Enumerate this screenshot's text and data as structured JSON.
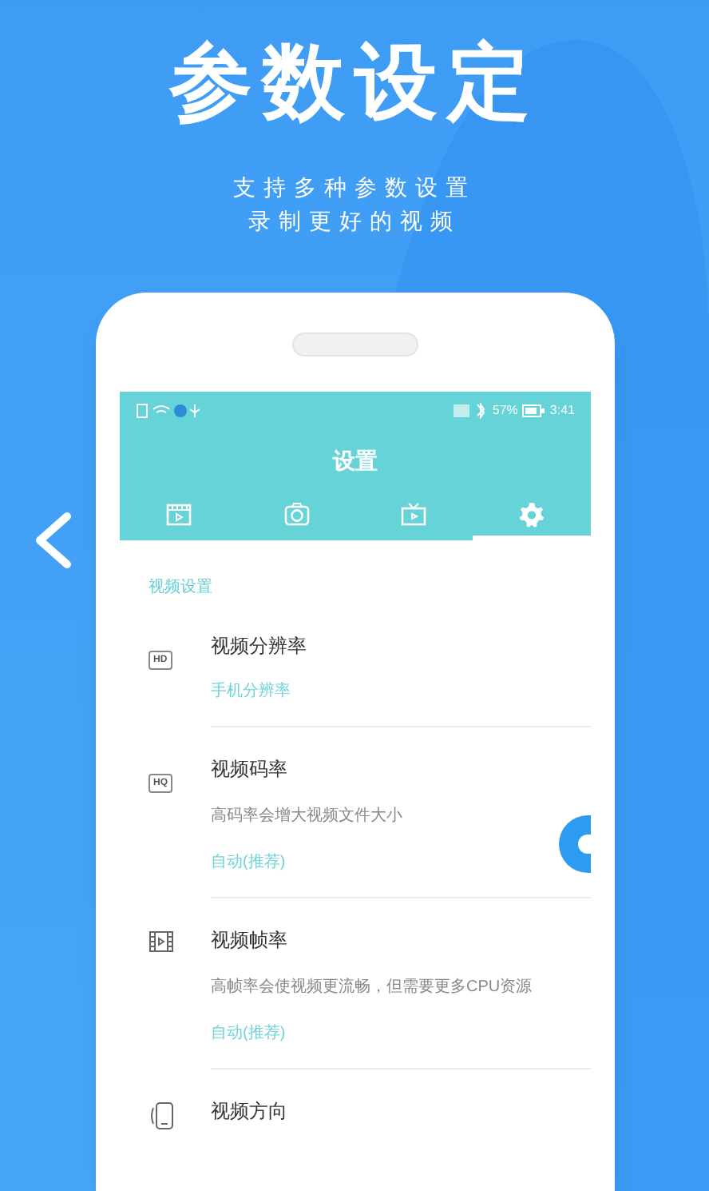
{
  "headline": "参数设定",
  "subtitle_lines": [
    "支持多种参数设置",
    "录制更好的视频"
  ],
  "status_bar": {
    "battery_text": "57%",
    "time": "3:41"
  },
  "app_title": "设置",
  "tabs": [
    {
      "kind": "clapper",
      "selected": false
    },
    {
      "kind": "camera",
      "selected": false
    },
    {
      "kind": "tv",
      "selected": false
    },
    {
      "kind": "gear",
      "selected": true
    }
  ],
  "section_title": "视频设置",
  "settings": [
    {
      "kind": "badge",
      "badge": "HD",
      "title": "视频分辨率",
      "value": "手机分辨率"
    },
    {
      "kind": "badge",
      "badge": "HQ",
      "title": "视频码率",
      "description": "高码率会增大视频文件大小",
      "value": "自动(推荐)"
    },
    {
      "kind": "film",
      "title": "视频帧率",
      "description": "高帧率会使视频更流畅，但需要更多CPU资源",
      "value": "自动(推荐)"
    },
    {
      "kind": "phone",
      "title": "视频方向"
    }
  ]
}
